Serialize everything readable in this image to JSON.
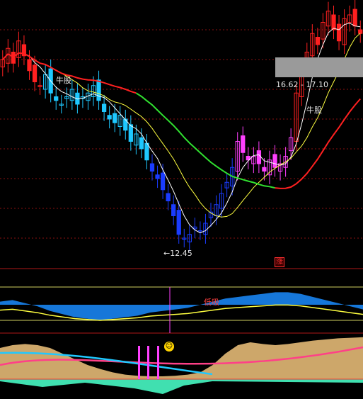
{
  "labels": {
    "bull_left": "牛股",
    "bull_right": "牛股",
    "low_price": "←12.45",
    "range": "16.62 - 17.10",
    "zhang": "涨",
    "dixi": "低吸"
  },
  "colors": {
    "up": "#ff2020",
    "down_cyan": "#1ec8ff",
    "down_blue": "#1a3cff",
    "magenta": "#ff40ff",
    "ma_white": "#ffffff",
    "ma_yellow": "#ffff40",
    "ma_long_red": "#ff2020",
    "ma_long_green": "#30e030",
    "grid": "#8a1010",
    "tan": "#d8b070",
    "pink": "#ff4088",
    "cyan_line": "#20c8ff",
    "mint": "#40e0b0"
  },
  "chart_data": [
    {
      "type": "candlestick",
      "panel": "price",
      "low_annotation": 12.45,
      "range_annotation": [
        16.62,
        17.1
      ],
      "series": [
        {
          "name": "",
          "kind": "close",
          "values": [
            17.6,
            17.9,
            17.5,
            18.1,
            17.7,
            17.3,
            17.0,
            16.9,
            17.2,
            16.7,
            16.5,
            16.4,
            16.6,
            16.8,
            16.4,
            16.6,
            16.7,
            16.9,
            16.5,
            16.2,
            16.0,
            15.9,
            16.1,
            15.7,
            15.4,
            15.6,
            15.2,
            14.9,
            14.6,
            14.4,
            14.1,
            13.8,
            13.4,
            12.9,
            12.8,
            12.9,
            13.1,
            13.0,
            13.2,
            13.5,
            13.7,
            14.0,
            14.3,
            14.7,
            15.4,
            15.1,
            14.9,
            15.0,
            14.8,
            14.6,
            14.9,
            14.7,
            14.8,
            15.0,
            15.5,
            16.7,
            17.3,
            17.8,
            18.3,
            18.0,
            18.6,
            18.9,
            18.4,
            18.1,
            18.7,
            18.8,
            18.5,
            18.3
          ]
        },
        {
          "name": "",
          "kind": "ma_short",
          "values": []
        },
        {
          "name": "",
          "kind": "ma_mid",
          "values": []
        },
        {
          "name": "",
          "kind": "ma_long",
          "values": []
        }
      ]
    },
    {
      "type": "area",
      "panel": "indicator_1",
      "series": [
        {
          "name": "",
          "values": [
            0.2,
            0.3,
            0.1,
            -0.1,
            -0.4,
            -0.6,
            -0.8,
            -0.9,
            -1.0,
            -0.9,
            -0.8,
            -0.7,
            -0.5,
            -0.4,
            -0.3,
            -0.2,
            0.0,
            0.2,
            0.4,
            0.5,
            0.6,
            0.7,
            0.8,
            0.8,
            0.7,
            0.5,
            0.3,
            0.1,
            -0.1,
            -0.3
          ]
        }
      ]
    },
    {
      "type": "area",
      "panel": "indicator_2",
      "series": [
        {
          "name": "",
          "values": [
            0.55,
            0.6,
            0.62,
            0.6,
            0.55,
            0.45,
            0.35,
            0.25,
            0.18,
            0.12,
            0.08,
            0.06,
            0.05,
            0.05,
            0.06,
            0.08,
            0.12,
            0.25,
            0.45,
            0.6,
            0.65,
            0.62,
            0.6,
            0.62,
            0.65,
            0.68,
            0.7,
            0.72,
            0.73,
            0.74
          ]
        }
      ]
    }
  ]
}
